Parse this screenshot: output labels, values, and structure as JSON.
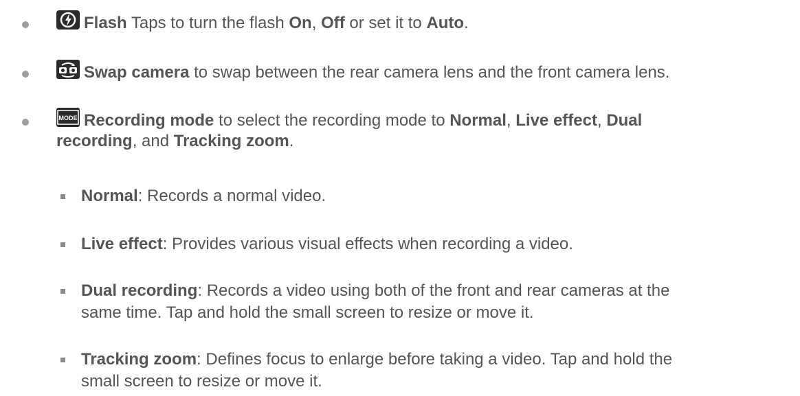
{
  "items": [
    {
      "icon": "flash-icon",
      "title": "Flash",
      "text_before": " Taps to turn the flash ",
      "opt1": "On",
      "sep1": ", ",
      "opt2": "Off",
      "sep2": " or set it to ",
      "opt3": "Auto",
      "end": "."
    },
    {
      "icon": "swap-camera-icon",
      "title": "Swap camera",
      "text": " to swap between the rear camera lens and the front camera lens."
    },
    {
      "icon": "mode-icon",
      "icon_label": "MODE",
      "title": "Recording mode",
      "text_before": " to select the recording mode to ",
      "opt1": "Normal",
      "sep1": ", ",
      "opt2": "Live effect",
      "sep2": ", ",
      "opt3": "Dual",
      "line2_opt3_cont": "recording",
      "sep3": ", and ",
      "opt4": "Tracking zoom",
      "end": "."
    }
  ],
  "sub_items": [
    {
      "title": "Normal",
      "text": ": Records a normal video."
    },
    {
      "title": "Live effect",
      "text": ": Provides various visual effects when recording a video."
    },
    {
      "title": "Dual recording",
      "text_line1": ": Records a video using both of the front and rear cameras at the",
      "text_line2": "same time. Tap and hold the small screen to resize or move it."
    },
    {
      "title": "Tracking zoom",
      "text_line1": ": Defines focus to enlarge before taking a video. Tap and hold the",
      "text_line2": "small screen to resize or move it."
    }
  ]
}
